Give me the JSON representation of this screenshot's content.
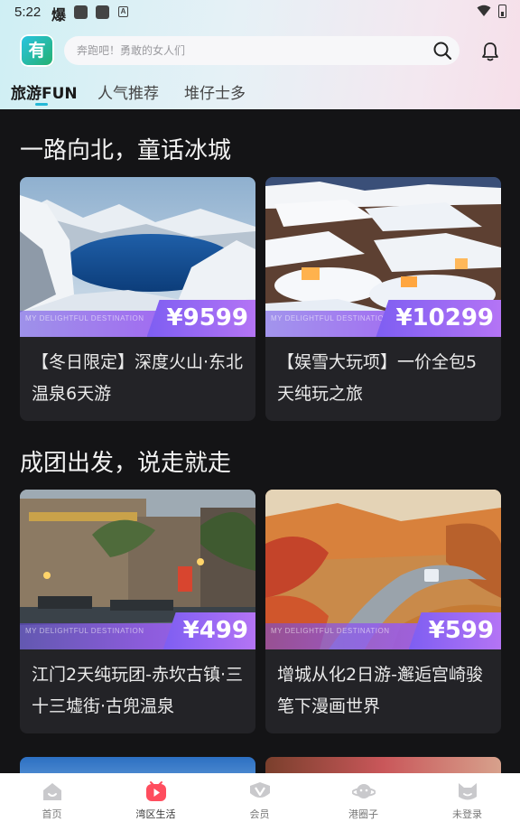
{
  "status_bar": {
    "time": "5:22",
    "glyph": "爆",
    "a_icon": "A"
  },
  "header": {
    "logo_text": "有",
    "search_placeholder": "奔跑吧！勇敢的女人们",
    "tabs": [
      {
        "label": "旅游FUN",
        "active": true
      },
      {
        "label": "人气推荐",
        "active": false
      },
      {
        "label": "堆仔士多",
        "active": false
      }
    ]
  },
  "sections": [
    {
      "title": "一路向北，童话冰城",
      "cards": [
        {
          "price": "¥9599",
          "title": "【冬日限定】深度火山·东北温泉6天游",
          "band_text": "MY DELIGHTFUL DESTINATION",
          "image": "snow-mountain-lake"
        },
        {
          "price": "¥10299",
          "title": "【娱雪大玩项】一价全包5天纯玩之旅",
          "band_text": "MY DELIGHTFUL DESTINATION",
          "image": "snow-village"
        }
      ]
    },
    {
      "title": "成团出发，说走就走",
      "cards": [
        {
          "price": "¥499",
          "title": "江门2天纯玩团-赤坎古镇·三十三墟街·古兜温泉",
          "band_text": "MY DELIGHTFUL DESTINATION",
          "image": "old-town-street"
        },
        {
          "price": "¥599",
          "title": "增城从化2日游-邂逅宫崎骏笔下漫画世界",
          "band_text": "MY DELIGHTFUL DESTINATION",
          "image": "autumn-road"
        }
      ]
    }
  ],
  "bottom_nav": [
    {
      "label": "首页",
      "icon": "home-icon",
      "active": false
    },
    {
      "label": "湾区生活",
      "icon": "play-icon",
      "active": true
    },
    {
      "label": "会员",
      "icon": "vip-icon",
      "active": false
    },
    {
      "label": "港圈子",
      "icon": "planet-icon",
      "active": false
    },
    {
      "label": "未登录",
      "icon": "cat-icon",
      "active": false
    }
  ],
  "colors": {
    "accent": "#24b8d6",
    "price_gradient_start": "#7e5ef2",
    "price_gradient_end": "#b474f5",
    "active_nav": "#ff4d5e"
  }
}
